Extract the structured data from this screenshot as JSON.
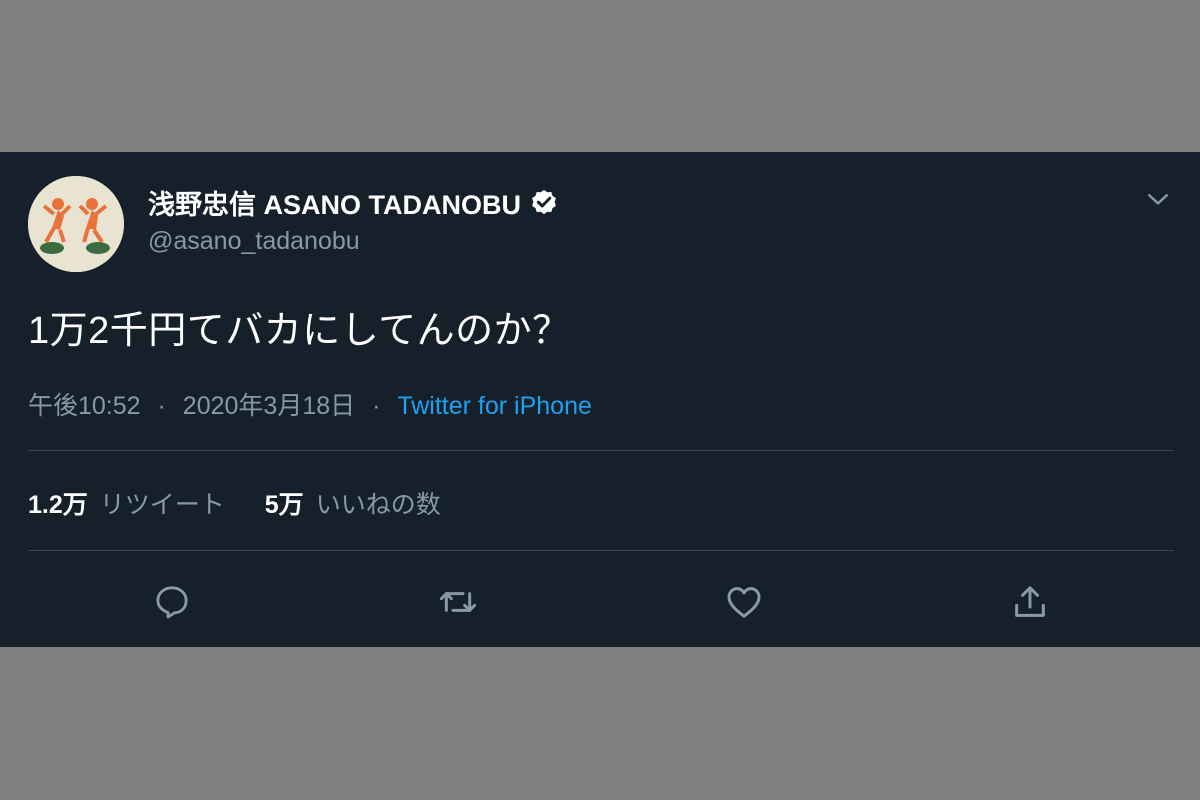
{
  "tweet": {
    "author": {
      "display_name": "浅野忠信 ASANO TADANOBU",
      "handle": "@asano_tadanobu",
      "verified": true,
      "avatar_icon": "avatar-image"
    },
    "text": "1万2千円てバカにしてんのか？",
    "time": "午後10:52",
    "date": "2020年3月18日",
    "separator": "·",
    "source": "Twitter for iPhone",
    "stats": {
      "retweets": {
        "count": "1.2万",
        "label": "リツイート"
      },
      "likes": {
        "count": "5万",
        "label": "いいねの数"
      }
    },
    "actions": [
      "reply-icon",
      "retweet-icon",
      "like-icon",
      "share-icon"
    ]
  },
  "colors": {
    "background": "#15202b",
    "text": "#ffffff",
    "muted": "#8899a6",
    "accent": "#1da1f2",
    "divider": "#38444d"
  }
}
